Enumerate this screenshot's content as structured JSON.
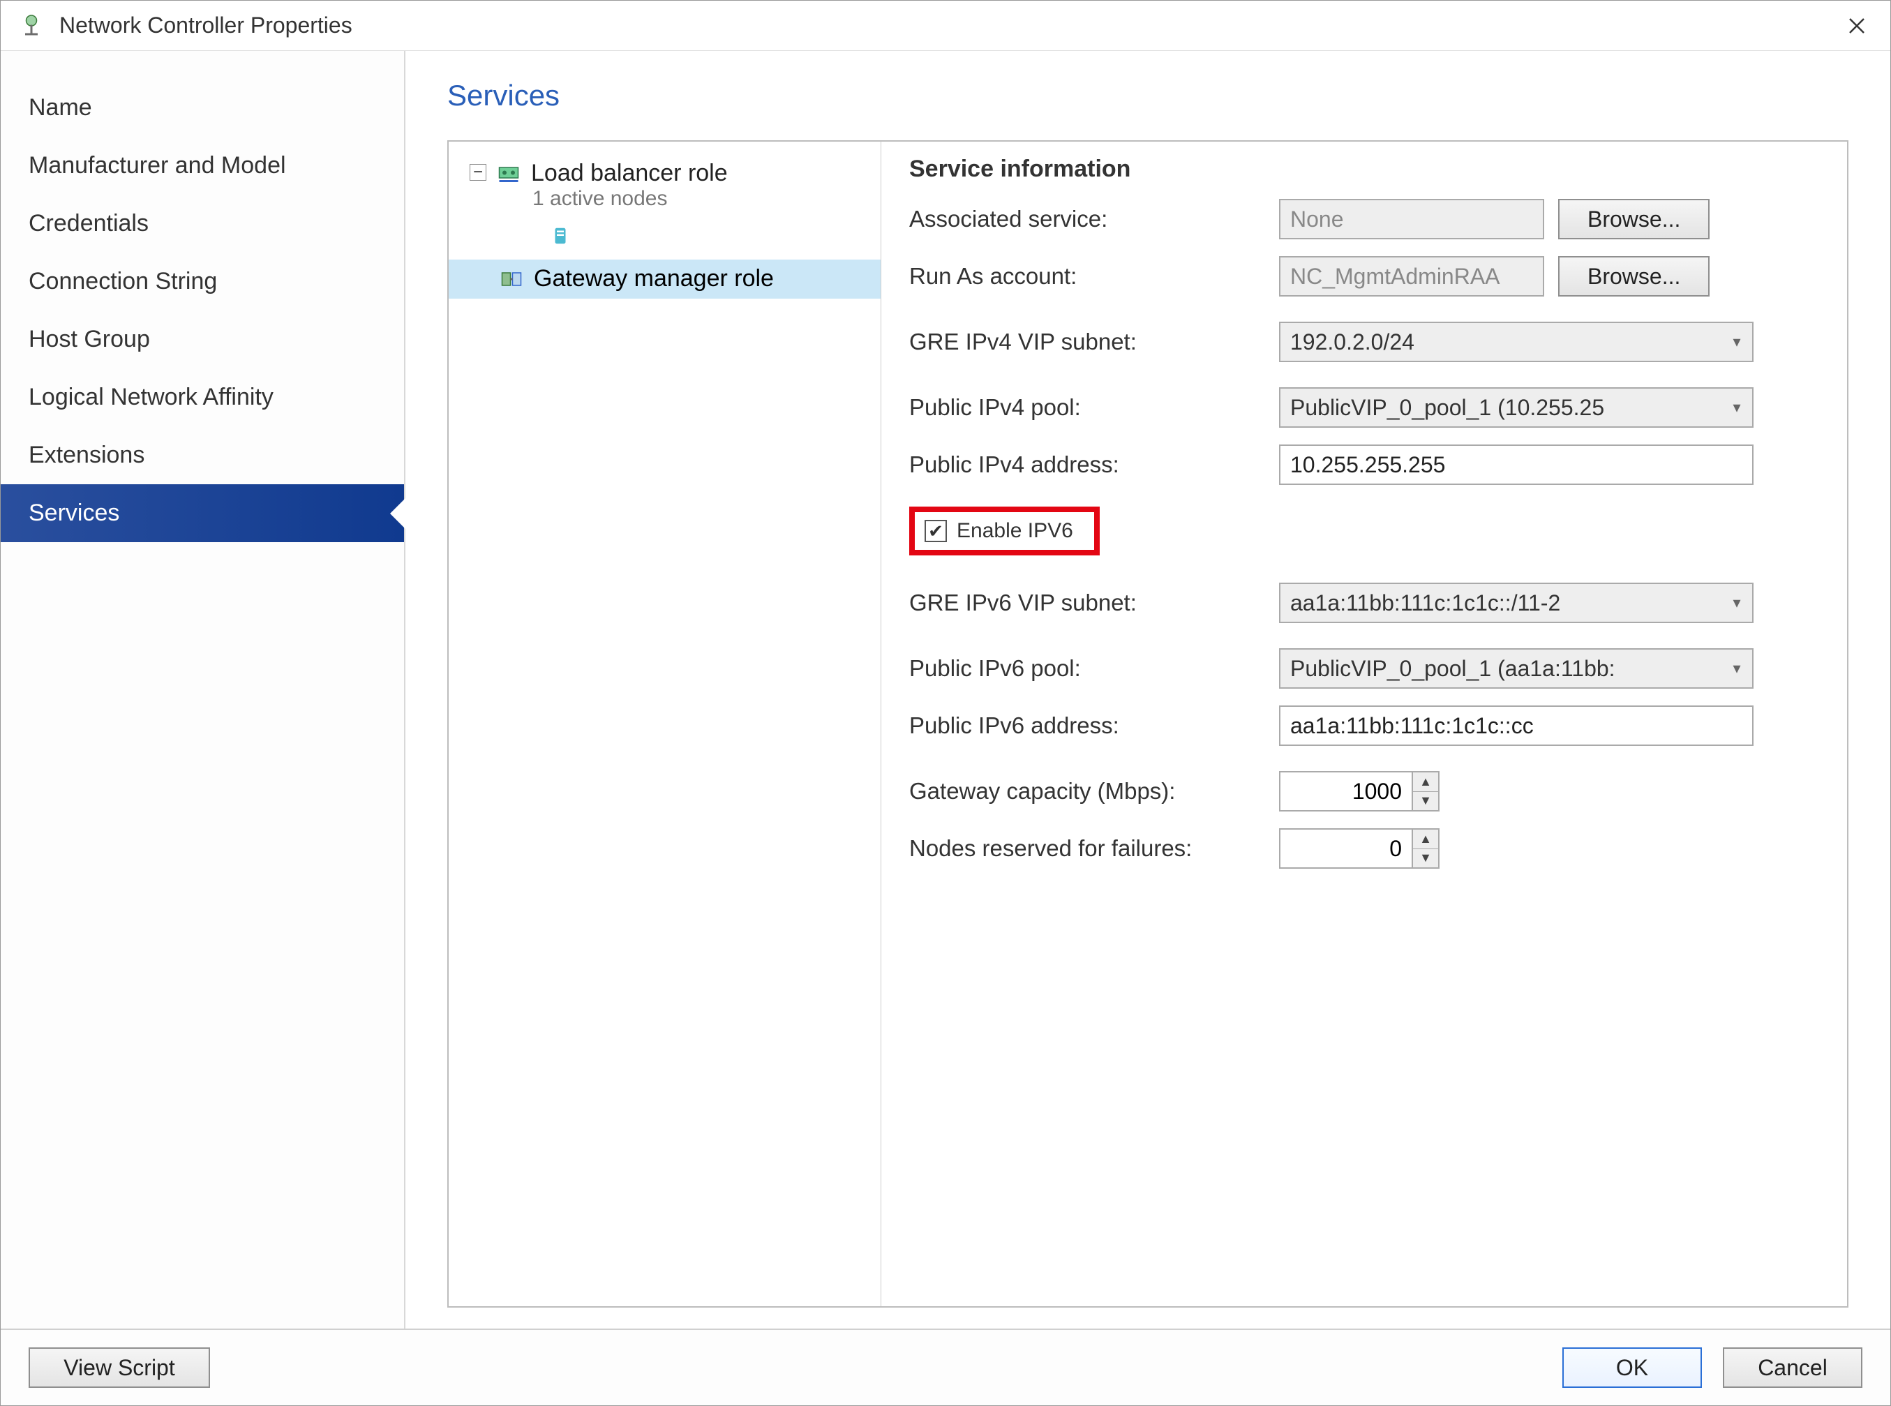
{
  "window": {
    "title": "Network Controller Properties"
  },
  "sidebar": {
    "items": [
      {
        "label": "Name"
      },
      {
        "label": "Manufacturer and Model"
      },
      {
        "label": "Credentials"
      },
      {
        "label": "Connection String"
      },
      {
        "label": "Host Group"
      },
      {
        "label": "Logical Network Affinity"
      },
      {
        "label": "Extensions"
      },
      {
        "label": "Services"
      }
    ],
    "selected_index": 7
  },
  "page": {
    "title": "Services"
  },
  "tree": {
    "items": [
      {
        "label": "Load balancer role",
        "sub": "1 active nodes",
        "expanded": true
      },
      {
        "label": "Gateway manager role",
        "selected": true
      }
    ]
  },
  "detail": {
    "heading": "Service information",
    "associated_service_label": "Associated service:",
    "associated_service_value": "None",
    "run_as_label": "Run As account:",
    "run_as_value": "NC_MgmtAdminRAA",
    "browse_label": "Browse...",
    "gre_ipv4_label": "GRE IPv4 VIP subnet:",
    "gre_ipv4_value": "192.0.2.0/24",
    "public_ipv4_pool_label": "Public IPv4 pool:",
    "public_ipv4_pool_value": "PublicVIP_0_pool_1 (10.255.25",
    "public_ipv4_addr_label": "Public IPv4 address:",
    "public_ipv4_addr_value": "10.255.255.255",
    "enable_ipv6_label": "Enable IPV6",
    "enable_ipv6_checked": true,
    "gre_ipv6_label": "GRE IPv6 VIP subnet:",
    "gre_ipv6_value": "aa1a:11bb:111c:1c1c::/11-2",
    "public_ipv6_pool_label": "Public IPv6 pool:",
    "public_ipv6_pool_value": "PublicVIP_0_pool_1 (aa1a:11bb:",
    "public_ipv6_addr_label": "Public IPv6 address:",
    "public_ipv6_addr_value": "aa1a:11bb:111c:1c1c::cc",
    "gw_capacity_label": "Gateway capacity (Mbps):",
    "gw_capacity_value": "1000",
    "nodes_reserved_label": "Nodes reserved for failures:",
    "nodes_reserved_value": "0"
  },
  "footer": {
    "view_script": "View Script",
    "ok": "OK",
    "cancel": "Cancel"
  }
}
